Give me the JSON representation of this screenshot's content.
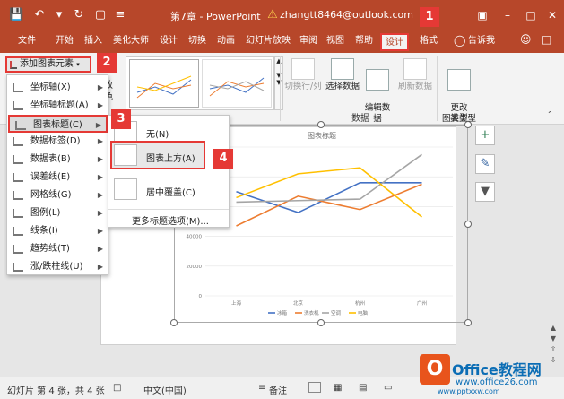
{
  "titlebar": {
    "doc_title": "第7章 - PowerPoint",
    "account": "zhangtt8464@outlook.com",
    "icons": [
      "save-icon",
      "undo-icon",
      "redo-icon",
      "present-icon",
      "qat-menu-icon",
      "warning-icon",
      "restore-icon",
      "minimize-icon",
      "maximize-icon",
      "close-icon"
    ]
  },
  "tabs": [
    "文件",
    "开始",
    "插入",
    "美化大师",
    "设计",
    "切换",
    "动画",
    "幻灯片放映",
    "审阅",
    "视图",
    "帮助",
    "设计",
    "格式"
  ],
  "tell_me": "告诉我",
  "ribbon": {
    "add_chart_element": "添加图表元素",
    "quick_layout": "改\n色",
    "switch_row_col": "切换行/列",
    "select_data": "选择数据",
    "edit_data": "编辑数\n据",
    "refresh_data": "刷新数据",
    "data_group": "数据",
    "change_type": "更改\n图表类型",
    "type_group": "类型"
  },
  "menu": {
    "items": [
      {
        "label": "坐标轴(X)",
        "icon": "axes-icon"
      },
      {
        "label": "坐标轴标题(A)",
        "icon": "axis-title-icon"
      },
      {
        "label": "图表标题(C)",
        "icon": "chart-title-icon"
      },
      {
        "label": "数据标签(D)",
        "icon": "data-labels-icon"
      },
      {
        "label": "数据表(B)",
        "icon": "data-table-icon"
      },
      {
        "label": "误差线(E)",
        "icon": "error-bars-icon"
      },
      {
        "label": "网格线(G)",
        "icon": "gridlines-icon"
      },
      {
        "label": "图例(L)",
        "icon": "legend-icon"
      },
      {
        "label": "线条(I)",
        "icon": "lines-icon"
      },
      {
        "label": "趋势线(T)",
        "icon": "trendline-icon"
      },
      {
        "label": "涨/跌柱线(U)",
        "icon": "updown-bars-icon"
      }
    ]
  },
  "submenu": {
    "none": "无(N)",
    "above_chart": "图表上方(A)",
    "centered_overlay": "居中覆盖(C)",
    "more_options": "更多标题选项(M)..."
  },
  "badges": [
    "1",
    "2",
    "3",
    "4"
  ],
  "colors": {
    "accent": "#b7472a",
    "highlight": "#e53935"
  },
  "chart_data": {
    "type": "line",
    "title": "图表标题",
    "categories": [
      "上海",
      "北京",
      "杭州",
      "广州"
    ],
    "ylim": [
      0,
      100000
    ],
    "yticks": [
      "0",
      "20000",
      "40000",
      "60000",
      "80000",
      "100000"
    ],
    "series": [
      {
        "name": "冰箱",
        "color": "#4472c4",
        "values": [
          70000,
          56000,
          76000,
          76000
        ]
      },
      {
        "name": "洗衣机",
        "color": "#ed7d31",
        "values": [
          47000,
          67000,
          58000,
          75000
        ]
      },
      {
        "name": "空调",
        "color": "#a5a5a5",
        "values": [
          63000,
          64000,
          65000,
          95000
        ]
      },
      {
        "name": "电脑",
        "color": "#ffc000",
        "values": [
          66000,
          82000,
          86000,
          53000
        ]
      }
    ],
    "grid": true,
    "legend": "bottom"
  },
  "status": {
    "slide_info": "幻灯片 第 4 张，共 4 张",
    "language": "中文(中国)",
    "notes": "备注"
  },
  "watermark": {
    "brand": "Office教程网",
    "url": "www.office26.com",
    "url_prefix": "www.pptxxw.com"
  }
}
